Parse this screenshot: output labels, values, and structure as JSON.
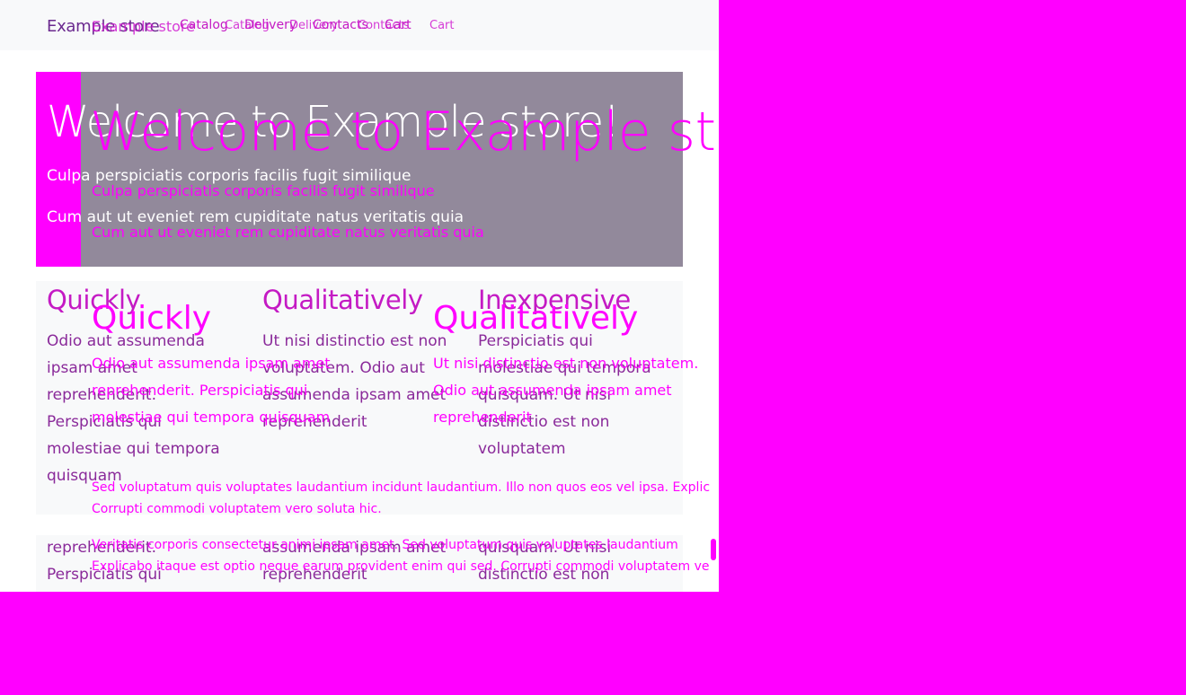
{
  "layer_a": {
    "brand": "Example store",
    "nav": [
      "Catalog",
      "Delivery",
      "Contacts",
      "Cart"
    ],
    "hero": {
      "title": "Welcome to Example store!",
      "line1": "Culpa perspiciatis corporis facilis fugit similique",
      "line2": "Cum aut ut eveniet rem cupiditate natus veritatis quia"
    },
    "cards": [
      {
        "title": "Quickly",
        "body": "Odio aut assumenda ipsam amet reprehenderit. Perspiciatis qui molestiae qui tempora quisquam"
      },
      {
        "title": "Qualitatively",
        "body": "Ut nisi distinctio est non voluptatem. Odio aut assumenda ipsam amet reprehenderit"
      },
      {
        "title": "Inexpensive",
        "body": "Perspiciatis qui molestiae qui tempora quisquam. Ut nisi distinctio est non voluptatem"
      }
    ],
    "cards_row2": [
      "reprehenderit. Perspiciatis qui",
      "assumenda ipsam amet reprehenderit",
      "quisquam. Ut nisi distinctio est non"
    ]
  },
  "layer_b": {
    "brand": "Example store",
    "nav": [
      "Catalog",
      "Delivery",
      "Contacts",
      "Cart"
    ],
    "hero": {
      "title": "Welcome to Example store",
      "line1": "Culpa perspiciatis corporis facilis fugit similique",
      "line2": "Cum aut ut eveniet rem cupiditate natus veritatis quia"
    },
    "cards": [
      {
        "title": "Quickly",
        "body": "Odio aut assumenda ipsam amet reprehenderit. Perspiciatis qui molestiae qui tempora quisquam"
      },
      {
        "title": "Qualitatively",
        "body": "Ut nisi distinctio est non voluptatem. Odio aut assumenda ipsam amet reprehenderit"
      }
    ],
    "footer": {
      "line1": "Sed voluptatum quis voluptates laudantium incidunt laudantium. Illo non quos eos vel ipsa. Explic",
      "line2": "Corrupti commodi voluptatem vero soluta hic.",
      "line3": "Veritatis corporis consectetur animi ipsam amet. Sed voluptatum quis voluptates laudantium",
      "line4": "Explicabo itaque est optio neque earum provident enim qui sed. Corrupti commodi voluptatem ve"
    }
  },
  "colors": {
    "magenta": "#ff00ff",
    "hero_gray": "#8c9096",
    "light_bg": "#f8f9fa"
  }
}
